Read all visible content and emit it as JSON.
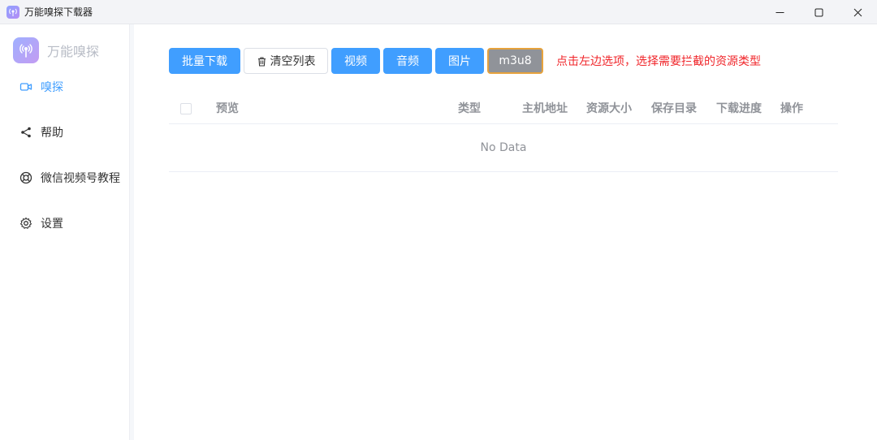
{
  "window": {
    "title": "万能嗅探下载器",
    "controls": [
      "minimize-icon",
      "maximize-icon",
      "close-icon"
    ]
  },
  "sidebar": {
    "brand": "万能嗅探",
    "items": [
      {
        "label": "嗅探",
        "icon": "video-camera-icon",
        "active": true
      },
      {
        "label": "帮助",
        "icon": "share-icon",
        "active": false
      },
      {
        "label": "微信视频号教程",
        "icon": "lifebuoy-icon",
        "active": false
      },
      {
        "label": "设置",
        "icon": "gear-icon",
        "active": false
      }
    ]
  },
  "toolbar": {
    "batch_download": "批量下载",
    "clear_list": "清空列表",
    "video": "视频",
    "audio": "音频",
    "image": "图片",
    "m3u8": "m3u8",
    "hint": "点击左边选项，选择需要拦截的资源类型"
  },
  "table": {
    "columns": [
      "预览",
      "类型",
      "主机地址",
      "资源大小",
      "保存目录",
      "下载进度",
      "操作"
    ],
    "empty_text": "No Data"
  },
  "colors": {
    "primary": "#409eff",
    "selected": "#909399",
    "selected_border": "#e6a23c",
    "hint": "#f0252a"
  }
}
